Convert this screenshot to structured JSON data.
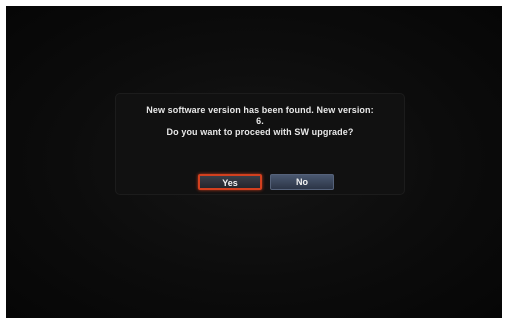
{
  "dialog": {
    "message_line1": "New software version has been found. New version:",
    "message_line2": "6.",
    "message_line3": "Do you want to proceed with SW upgrade?",
    "yes_label": "Yes",
    "no_label": "No",
    "focused_button": "Yes"
  },
  "colors": {
    "screen_background": "#0a0a0a",
    "dialog_background": "#111111",
    "focus_border": "#d2401f",
    "button_no": "#3a4760",
    "text": "#e8e8e8"
  }
}
